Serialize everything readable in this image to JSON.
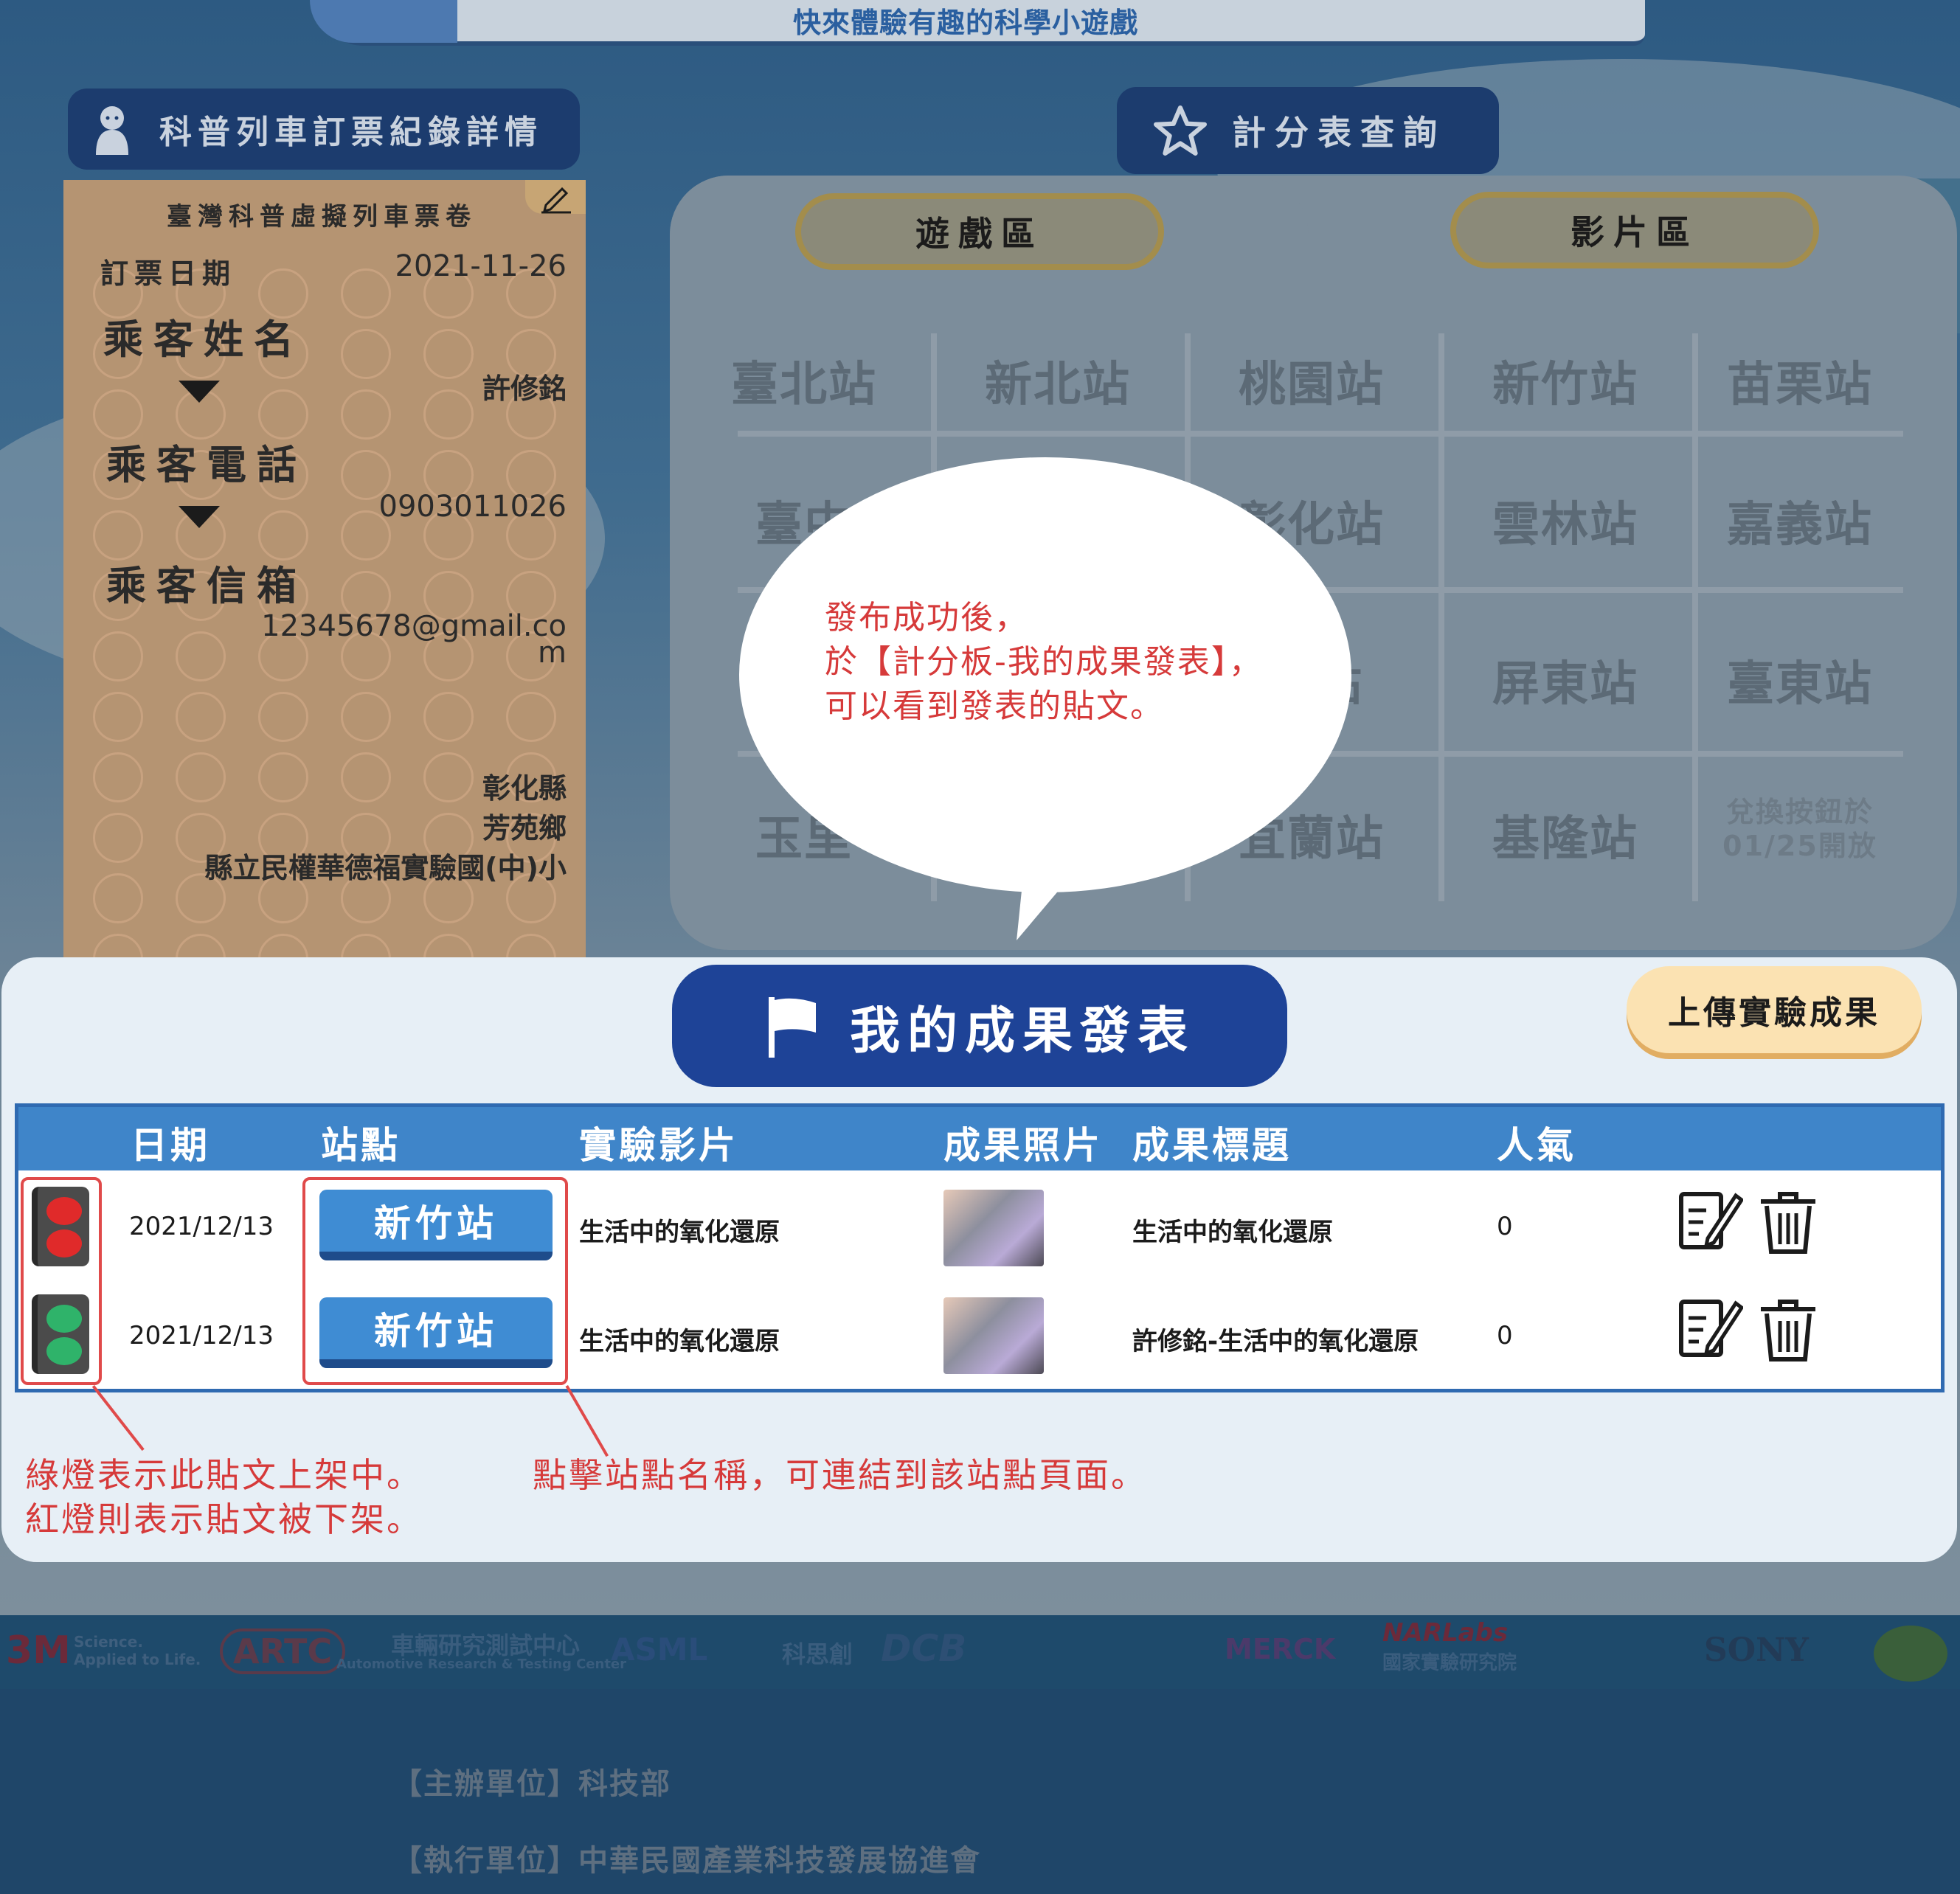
{
  "banner": {
    "tagline": "快來體驗有趣的科學小遊戲"
  },
  "header": {
    "booking_record_label": "科普列車訂票紀錄詳情",
    "score_query_label": "計分表查詢"
  },
  "ticket": {
    "title": "臺灣科普虛擬列車票卷",
    "booking_date_label": "訂票日期",
    "booking_date": "2021-11-26",
    "name_label": "乘客姓名",
    "name": "許修銘",
    "phone_label": "乘客電話",
    "phone": "0903011026",
    "email_label": "乘客信箱",
    "email_line1": "12345678@gmail.co",
    "email_line2": "m",
    "county": "彰化縣",
    "township": "芳苑鄉",
    "school": "縣立民權華德福實驗國(中)小"
  },
  "tabs": {
    "game": "遊戲區",
    "video": "影片區"
  },
  "stations": {
    "r1": [
      "臺北站",
      "新北站",
      "桃園站",
      "新竹站",
      "苗栗站"
    ],
    "r2": [
      "臺中",
      "",
      "彰化站",
      "雲林站",
      "嘉義站"
    ],
    "r3": [
      "",
      "",
      "站",
      "屏東站",
      "臺東站"
    ],
    "r4": [
      "玉里",
      "",
      "宜蘭站",
      "基隆站",
      ""
    ],
    "locked_line1": "兌換按鈕於",
    "locked_line2": "01/25開放"
  },
  "bubble": {
    "line1": "發布成功後，",
    "line2": "於【計分板-我的成果發表】，",
    "line3": "可以看到發表的貼文。"
  },
  "results": {
    "title": "我的成果發表",
    "upload_label": "上傳實驗成果",
    "columns": {
      "date": "日期",
      "station": "站點",
      "video": "實驗影片",
      "photo": "成果照片",
      "post_title": "成果標題",
      "popularity": "人氣"
    },
    "rows": [
      {
        "status": "red",
        "date": "2021/12/13",
        "station": "新竹站",
        "video": "生活中的氧化還原",
        "title": "生活中的氧化還原",
        "popularity": "0"
      },
      {
        "status": "green",
        "date": "2021/12/13",
        "station": "新竹站",
        "video": "生活中的氧化還原",
        "title": "許修銘-生活中的氧化還原",
        "popularity": "0"
      }
    ]
  },
  "notes": {
    "light_line1": "綠燈表示此貼文上架中。",
    "light_line2": "紅燈則表示貼文被下架。",
    "station_note": "點擊站點名稱，可連結到該站點頁面。"
  },
  "sponsors": {
    "threem": "3M",
    "threem_tag1": "Science.",
    "threem_tag2": "Applied to Life.",
    "artc": "ARTC",
    "artc_cn": "車輛研究測試中心",
    "artc_en": "Automotive Research & Testing Center",
    "asml": "ASML",
    "kesichuang": "科思創",
    "dcb": "DCB",
    "merck": "MERCK",
    "narlabs": "NARLabs",
    "narlabs_cn": "國家實驗研究院",
    "sony": "SONY"
  },
  "footer": {
    "organizer": "【主辦單位】科技部",
    "executor": "【執行單位】中華民國產業科技發展協進會"
  },
  "colors": {
    "primary_blue": "#1e4397",
    "table_header": "#3f85c9",
    "annotation_red": "#d63a3a",
    "light_red": "#e02a2a",
    "light_green": "#2fb36a"
  }
}
